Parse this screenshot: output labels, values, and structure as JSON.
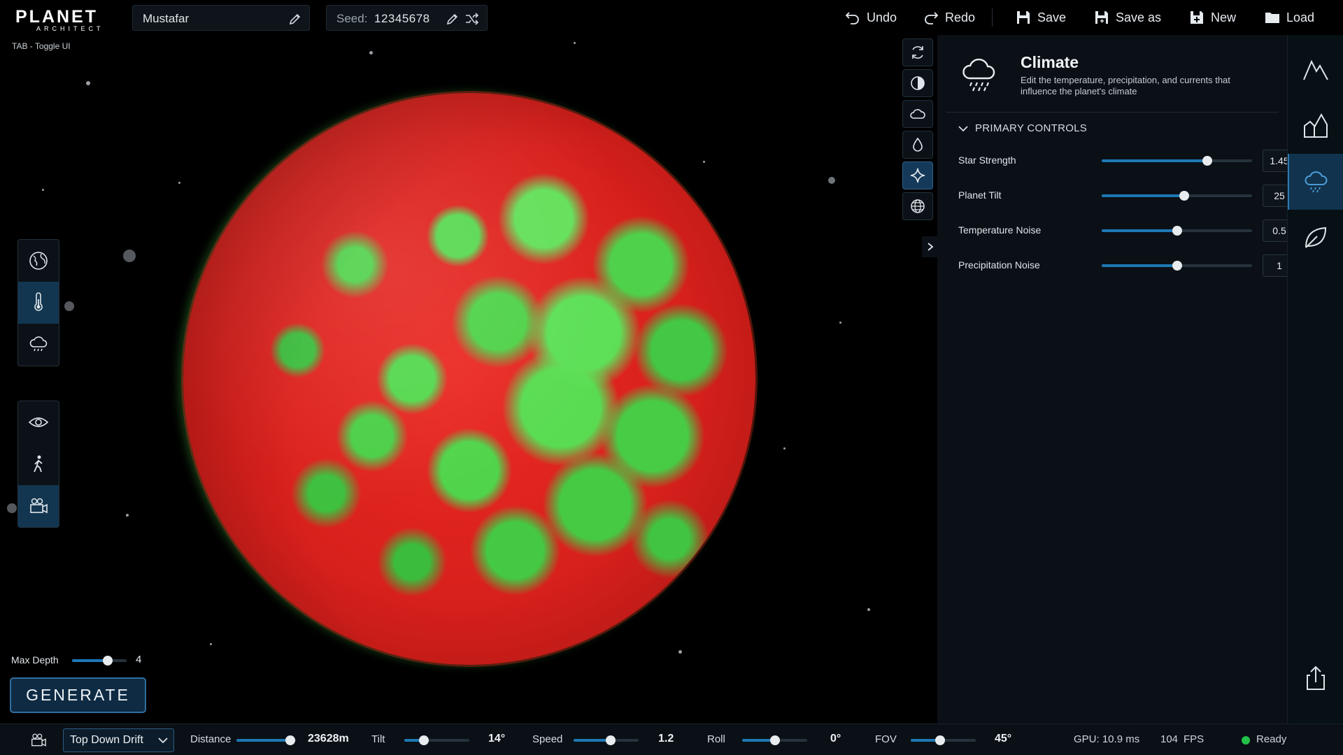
{
  "app": {
    "brand_main": "PLANET",
    "brand_sub": "ARCHITECT",
    "planet_name": "Mustafar",
    "seed_label": "Seed:",
    "seed_value": "12345678",
    "toggle_hint": "TAB - Toggle UI"
  },
  "toolbar": {
    "undo": "Undo",
    "redo": "Redo",
    "save": "Save",
    "save_as": "Save as",
    "new": "New",
    "load": "Load"
  },
  "left_tools": {
    "group1": [
      "globe-icon",
      "thermometer-icon",
      "cloud-rain-icon"
    ],
    "group1_active": "thermometer-icon",
    "group2": [
      "eye-icon",
      "walk-icon",
      "video-camera-icon"
    ],
    "group2_active": "video-camera-icon"
  },
  "mini_tools": {
    "items": [
      "refresh-icon",
      "shaded-sphere-icon",
      "cloud-icon",
      "water-drop-icon",
      "sparkle-icon",
      "grid-globe-icon"
    ],
    "active": "sparkle-icon"
  },
  "panel": {
    "title": "Climate",
    "description": "Edit the temperature, precipitation, and currents that influence the planet's climate",
    "section_title": "PRIMARY CONTROLS",
    "controls": [
      {
        "label": "Star Strength",
        "value": "1.45",
        "level": 0.7
      },
      {
        "label": "Planet Tilt",
        "value": "25",
        "level": 0.55
      },
      {
        "label": "Temperature Noise",
        "value": "0.5",
        "level": 0.5
      },
      {
        "label": "Precipitation Noise",
        "value": "1",
        "level": 0.5
      }
    ]
  },
  "rail": {
    "items": [
      "mountain-icon",
      "terrain-blocks-icon",
      "cloud-rain-icon",
      "leaf-icon",
      "export-icon"
    ],
    "active": "cloud-rain-icon"
  },
  "generate": {
    "max_depth_label": "Max Depth",
    "max_depth_value": "4",
    "max_depth_level": 0.65,
    "button": "GENERATE"
  },
  "camera": {
    "mode": "Top Down Drift",
    "distance_label": "Distance",
    "distance_value": "23628m",
    "distance_level": 0.9,
    "tilt_label": "Tilt",
    "tilt_value": "14°",
    "tilt_level": 0.3,
    "speed_label": "Speed",
    "speed_value": "1.2",
    "speed_level": 0.57,
    "roll_label": "Roll",
    "roll_value": "0°",
    "roll_level": 0.5,
    "fov_label": "FOV",
    "fov_value": "45°",
    "fov_level": 0.45
  },
  "status": {
    "gpu": "GPU: 10.9 ms",
    "fps_value": "104",
    "fps_label": "FPS",
    "state": "Ready"
  },
  "colors": {
    "accent": "#1d78b5",
    "panel_bg": "#0a1016",
    "planet_red": "#e0241f",
    "planet_green": "#50d44b",
    "ready_green": "#21c24a"
  }
}
